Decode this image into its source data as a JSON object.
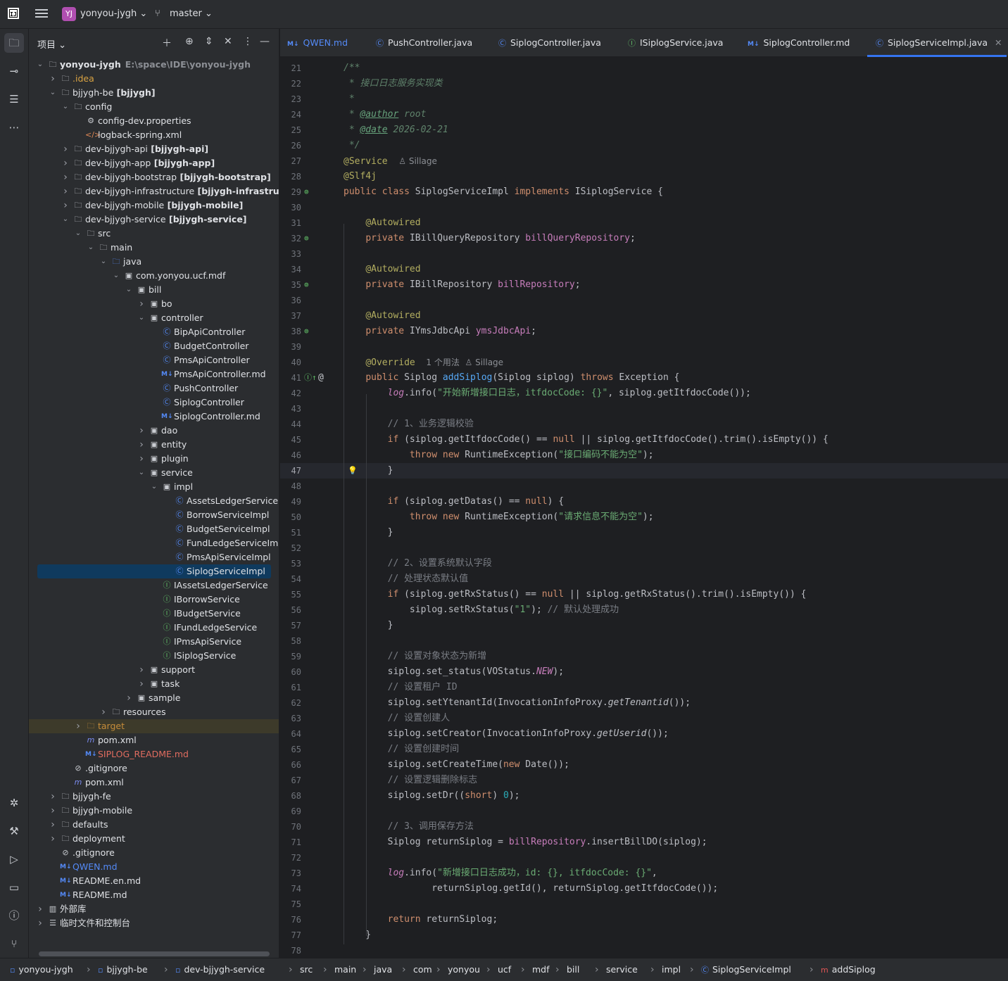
{
  "titlebar": {
    "logo": "IJ",
    "project_badge": "YJ",
    "project_name": "yonyou-jygh",
    "branch": "master"
  },
  "toolstrip": {
    "top_icons": [
      "folder-icon",
      "commit-icon",
      "structure-icon",
      "more-icon"
    ],
    "bottom_icons": [
      "debug-icon",
      "build-icon",
      "services-icon",
      "terminal-icon",
      "problems-icon",
      "git-icon"
    ]
  },
  "project_panel": {
    "title": "项目",
    "tree": [
      {
        "label": "yonyou-jygh",
        "path": "E:\\space\\IDE\\yonyou-jygh",
        "depth": 0,
        "arrow": "open",
        "icon": "folder",
        "bold": true
      },
      {
        "label": ".idea",
        "depth": 1,
        "arrow": "closed",
        "icon": "folder",
        "style": "idea"
      },
      {
        "label": "bjjygh-be",
        "module": "[bjjygh]",
        "depth": 1,
        "arrow": "open",
        "icon": "folder"
      },
      {
        "label": "config",
        "depth": 2,
        "arrow": "open",
        "icon": "folder"
      },
      {
        "label": "config-dev.properties",
        "depth": 3,
        "icon": "gear"
      },
      {
        "label": "logback-spring.xml",
        "depth": 3,
        "icon": "xml"
      },
      {
        "label": "dev-bjjygh-api",
        "module": "[bjjygh-api]",
        "depth": 2,
        "arrow": "closed",
        "icon": "folder"
      },
      {
        "label": "dev-bjjygh-app",
        "module": "[bjjygh-app]",
        "depth": 2,
        "arrow": "closed",
        "icon": "folder"
      },
      {
        "label": "dev-bjjygh-bootstrap",
        "module": "[bjjygh-bootstrap]",
        "depth": 2,
        "arrow": "closed",
        "icon": "folder"
      },
      {
        "label": "dev-bjjygh-infrastructure",
        "module": "[bjjygh-infrastructure",
        "depth": 2,
        "arrow": "closed",
        "icon": "folder"
      },
      {
        "label": "dev-bjjygh-mobile",
        "module": "[bjjygh-mobile]",
        "depth": 2,
        "arrow": "closed",
        "icon": "folder"
      },
      {
        "label": "dev-bjjygh-service",
        "module": "[bjjygh-service]",
        "depth": 2,
        "arrow": "open",
        "icon": "folder"
      },
      {
        "label": "src",
        "depth": 3,
        "arrow": "open",
        "icon": "folder"
      },
      {
        "label": "main",
        "depth": 4,
        "arrow": "open",
        "icon": "folder"
      },
      {
        "label": "java",
        "depth": 5,
        "arrow": "open",
        "icon": "folder-blue"
      },
      {
        "label": "com.yonyou.ucf.mdf",
        "depth": 6,
        "arrow": "open",
        "icon": "package"
      },
      {
        "label": "bill",
        "depth": 7,
        "arrow": "open",
        "icon": "package"
      },
      {
        "label": "bo",
        "depth": 8,
        "arrow": "closed",
        "icon": "package"
      },
      {
        "label": "controller",
        "depth": 8,
        "arrow": "open",
        "icon": "package"
      },
      {
        "label": "BipApiController",
        "depth": 9,
        "icon": "class"
      },
      {
        "label": "BudgetController",
        "depth": 9,
        "icon": "class"
      },
      {
        "label": "PmsApiController",
        "depth": 9,
        "icon": "class"
      },
      {
        "label": "PmsApiController.md",
        "depth": 9,
        "icon": "md"
      },
      {
        "label": "PushController",
        "depth": 9,
        "icon": "class"
      },
      {
        "label": "SiplogController",
        "depth": 9,
        "icon": "class"
      },
      {
        "label": "SiplogController.md",
        "depth": 9,
        "icon": "md"
      },
      {
        "label": "dao",
        "depth": 8,
        "arrow": "closed",
        "icon": "package"
      },
      {
        "label": "entity",
        "depth": 8,
        "arrow": "closed",
        "icon": "package"
      },
      {
        "label": "plugin",
        "depth": 8,
        "arrow": "closed",
        "icon": "package"
      },
      {
        "label": "service",
        "depth": 8,
        "arrow": "open",
        "icon": "package"
      },
      {
        "label": "impl",
        "depth": 9,
        "arrow": "open",
        "icon": "package"
      },
      {
        "label": "AssetsLedgerServiceIm",
        "depth": 10,
        "icon": "class"
      },
      {
        "label": "BorrowServiceImpl",
        "depth": 10,
        "icon": "class"
      },
      {
        "label": "BudgetServiceImpl",
        "depth": 10,
        "icon": "class"
      },
      {
        "label": "FundLedgeServiceImpl",
        "depth": 10,
        "icon": "class"
      },
      {
        "label": "PmsApiServiceImpl",
        "depth": 10,
        "icon": "class"
      },
      {
        "label": "SiplogServiceImpl",
        "depth": 10,
        "icon": "class",
        "selected": true
      },
      {
        "label": "IAssetsLedgerService",
        "depth": 9,
        "icon": "iface"
      },
      {
        "label": "IBorrowService",
        "depth": 9,
        "icon": "iface"
      },
      {
        "label": "IBudgetService",
        "depth": 9,
        "icon": "iface"
      },
      {
        "label": "IFundLedgeService",
        "depth": 9,
        "icon": "iface"
      },
      {
        "label": "IPmsApiService",
        "depth": 9,
        "icon": "iface"
      },
      {
        "label": "ISiplogService",
        "depth": 9,
        "icon": "iface"
      },
      {
        "label": "support",
        "depth": 8,
        "arrow": "closed",
        "icon": "package"
      },
      {
        "label": "task",
        "depth": 8,
        "arrow": "closed",
        "icon": "package"
      },
      {
        "label": "sample",
        "depth": 7,
        "arrow": "closed",
        "icon": "package"
      },
      {
        "label": "resources",
        "depth": 5,
        "arrow": "closed",
        "icon": "folder-res"
      },
      {
        "label": "target",
        "depth": 3,
        "arrow": "closed",
        "icon": "folder-target",
        "style": "target",
        "excluded": true
      },
      {
        "label": "pom.xml",
        "depth": 3,
        "icon": "mvn"
      },
      {
        "label": "SIPLOG_README.md",
        "depth": 3,
        "icon": "md",
        "style": "red"
      },
      {
        "label": ".gitignore",
        "depth": 2,
        "icon": "ignore"
      },
      {
        "label": "pom.xml",
        "depth": 2,
        "icon": "mvn"
      },
      {
        "label": "bjjygh-fe",
        "depth": 1,
        "arrow": "closed",
        "icon": "folder"
      },
      {
        "label": "bjjygh-mobile",
        "depth": 1,
        "arrow": "closed",
        "icon": "folder"
      },
      {
        "label": "defaults",
        "depth": 1,
        "arrow": "closed",
        "icon": "folder"
      },
      {
        "label": "deployment",
        "depth": 1,
        "arrow": "closed",
        "icon": "folder"
      },
      {
        "label": ".gitignore",
        "depth": 1,
        "icon": "ignore"
      },
      {
        "label": "QWEN.md",
        "depth": 1,
        "icon": "md",
        "style": "blue"
      },
      {
        "label": "README.en.md",
        "depth": 1,
        "icon": "md"
      },
      {
        "label": "README.md",
        "depth": 1,
        "icon": "md"
      },
      {
        "label": "外部库",
        "depth": 0,
        "arrow": "closed",
        "icon": "lib"
      },
      {
        "label": "临时文件和控制台",
        "depth": 0,
        "arrow": "closed",
        "icon": "scratch"
      }
    ]
  },
  "tabs": [
    {
      "label": "QWEN.md",
      "icon": "md",
      "style": "blue"
    },
    {
      "label": "PushController.java",
      "icon": "class"
    },
    {
      "label": "SiplogController.java",
      "icon": "class"
    },
    {
      "label": "ISiplogService.java",
      "icon": "iface"
    },
    {
      "label": "SiplogController.md",
      "icon": "md"
    },
    {
      "label": "SiplogServiceImpl.java",
      "icon": "class",
      "active": true,
      "close": "✕"
    }
  ],
  "editor": {
    "current_line": 47,
    "lines": [
      {
        "n": 21,
        "html": "<span class='c-doc'>/**</span>"
      },
      {
        "n": 22,
        "html": "<span class='c-doc'> * 接口日志服务实现类</span>"
      },
      {
        "n": 23,
        "html": "<span class='c-doc'> *</span>"
      },
      {
        "n": 24,
        "html": "<span class='c-doc'> * </span><span class='c-doctag'>@author</span><span class='c-doc'> root</span>"
      },
      {
        "n": 25,
        "html": "<span class='c-doc'> * </span><span class='c-doctag'>@date</span><span class='c-doc'> 2026-02-21</span>"
      },
      {
        "n": 26,
        "html": "<span class='c-doc'> */</span>"
      },
      {
        "n": 27,
        "html": "<span class='c-ann'>@Service</span>  <span class='c-inlay'>♙ Sillage</span>"
      },
      {
        "n": 28,
        "html": "<span class='c-ann'>@Slf4j</span>"
      },
      {
        "n": 29,
        "html": "<span class='c-kw'>public class</span> SiplogServiceImpl <span class='c-kw'>implements</span> ISiplogService {",
        "gutter": "bean"
      },
      {
        "n": 30,
        "html": ""
      },
      {
        "n": 31,
        "html": "    <span class='c-ann'>@Autowired</span>"
      },
      {
        "n": 32,
        "html": "    <span class='c-kw'>private</span> IBillQueryRepository <span class='c-field'>billQueryRepository</span>;",
        "gutter": "bean"
      },
      {
        "n": 33,
        "html": ""
      },
      {
        "n": 34,
        "html": "    <span class='c-ann'>@Autowired</span>"
      },
      {
        "n": 35,
        "html": "    <span class='c-kw'>private</span> IBillRepository <span class='c-field'>billRepository</span>;",
        "gutter": "bean"
      },
      {
        "n": 36,
        "html": ""
      },
      {
        "n": 37,
        "html": "    <span class='c-ann'>@Autowired</span>"
      },
      {
        "n": 38,
        "html": "    <span class='c-kw'>private</span> IYmsJdbcApi <span class='c-field'>ymsJdbcApi</span>;",
        "gutter": "bean"
      },
      {
        "n": 39,
        "html": ""
      },
      {
        "n": 40,
        "html": "    <span class='c-ann'>@Override</span>  <span class='c-inlay'>1 个用法  ♙ Sillage</span>"
      },
      {
        "n": 41,
        "html": "    <span class='c-kw'>public</span> Siplog <span class='c-method'>addSiplog</span>(Siplog siplog) <span class='c-kw'>throws</span> Exception {",
        "gutter": "override"
      },
      {
        "n": 42,
        "html": "        <span class='c-log'>log</span>.info(<span class='c-str'>\"开始新增接口日志，itfdocCode: {}\"</span>, siplog.getItfdocCode());"
      },
      {
        "n": 43,
        "html": ""
      },
      {
        "n": 44,
        "html": "        <span class='c-cmt'>// 1、业务逻辑校验</span>"
      },
      {
        "n": 45,
        "html": "        <span class='c-kw'>if</span> (siplog.getItfdocCode() == <span class='c-kw'>null</span> || siplog.getItfdocCode().trim().isEmpty()) {"
      },
      {
        "n": 46,
        "html": "            <span class='c-kw'>throw new</span> RuntimeException(<span class='c-str'>\"接口编码不能为空\"</span>);"
      },
      {
        "n": 47,
        "html": "        }",
        "gutter": "bulb"
      },
      {
        "n": 48,
        "html": ""
      },
      {
        "n": 49,
        "html": "        <span class='c-kw'>if</span> (siplog.getDatas() == <span class='c-kw'>null</span>) {"
      },
      {
        "n": 50,
        "html": "            <span class='c-kw'>throw new</span> RuntimeException(<span class='c-str'>\"请求信息不能为空\"</span>);"
      },
      {
        "n": 51,
        "html": "        }"
      },
      {
        "n": 52,
        "html": ""
      },
      {
        "n": 53,
        "html": "        <span class='c-cmt'>// 2、设置系统默认字段</span>"
      },
      {
        "n": 54,
        "html": "        <span class='c-cmt'>// 处理状态默认值</span>"
      },
      {
        "n": 55,
        "html": "        <span class='c-kw'>if</span> (siplog.getRxStatus() == <span class='c-kw'>null</span> || siplog.getRxStatus().trim().isEmpty()) {"
      },
      {
        "n": 56,
        "html": "            siplog.setRxStatus(<span class='c-str'>\"1\"</span>); <span class='c-cmt'>// 默认处理成功</span>"
      },
      {
        "n": 57,
        "html": "        }"
      },
      {
        "n": 58,
        "html": ""
      },
      {
        "n": 59,
        "html": "        <span class='c-cmt'>// 设置对象状态为新增</span>"
      },
      {
        "n": 60,
        "html": "        siplog.set_status(VOStatus.<span class='c-staticfield'>NEW</span>);"
      },
      {
        "n": 61,
        "html": "        <span class='c-cmt'>// 设置租户 ID</span>"
      },
      {
        "n": 62,
        "html": "        siplog.setYtenantId(InvocationInfoProxy.<span class='c-static'>getTenantid</span>());"
      },
      {
        "n": 63,
        "html": "        <span class='c-cmt'>// 设置创建人</span>"
      },
      {
        "n": 64,
        "html": "        siplog.setCreator(InvocationInfoProxy.<span class='c-static'>getUserid</span>());"
      },
      {
        "n": 65,
        "html": "        <span class='c-cmt'>// 设置创建时间</span>"
      },
      {
        "n": 66,
        "html": "        siplog.setCreateTime(<span class='c-kw'>new</span> Date());"
      },
      {
        "n": 67,
        "html": "        <span class='c-cmt'>// 设置逻辑删除标志</span>"
      },
      {
        "n": 68,
        "html": "        siplog.setDr((<span class='c-kw'>short</span>) <span class='c-num'>0</span>);"
      },
      {
        "n": 69,
        "html": ""
      },
      {
        "n": 70,
        "html": "        <span class='c-cmt'>// 3、调用保存方法</span>"
      },
      {
        "n": 71,
        "html": "        Siplog returnSiplog = <span class='c-field'>billRepository</span>.insertBillDO(siplog);"
      },
      {
        "n": 72,
        "html": ""
      },
      {
        "n": 73,
        "html": "        <span class='c-log'>log</span>.info(<span class='c-str'>\"新增接口日志成功，id: {}, itfdocCode: {}\"</span>,"
      },
      {
        "n": 74,
        "html": "                returnSiplog.getId(), returnSiplog.getItfdocCode());"
      },
      {
        "n": 75,
        "html": ""
      },
      {
        "n": 76,
        "html": "        <span class='c-kw'>return</span> returnSiplog;"
      },
      {
        "n": 77,
        "html": "    }"
      },
      {
        "n": 78,
        "html": ""
      }
    ]
  },
  "breadcrumb": [
    {
      "label": "yonyou-jygh",
      "icon": "module"
    },
    {
      "label": "bjjygh-be",
      "icon": "module"
    },
    {
      "label": "dev-bjjygh-service",
      "icon": "module"
    },
    {
      "label": "src"
    },
    {
      "label": "main"
    },
    {
      "label": "java"
    },
    {
      "label": "com"
    },
    {
      "label": "yonyou"
    },
    {
      "label": "ucf"
    },
    {
      "label": "mdf"
    },
    {
      "label": "bill"
    },
    {
      "label": "service"
    },
    {
      "label": "impl"
    },
    {
      "label": "SiplogServiceImpl",
      "icon": "class"
    },
    {
      "label": "addSiplog",
      "icon": "method"
    }
  ],
  "colors": {
    "accent": "#3574f0",
    "selection": "#0f3a5e",
    "editor_bg": "#1e1f22",
    "panel_bg": "#2b2d30"
  }
}
